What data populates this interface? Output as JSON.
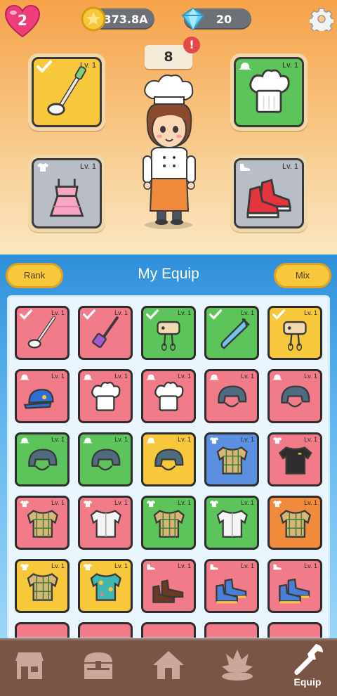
{
  "hud": {
    "lives": "2",
    "coins": "373.8A",
    "gems": "20",
    "level": "8",
    "alert": "!"
  },
  "equipped": [
    {
      "name": "ladle",
      "level": "Lv. 1",
      "color": "#f7c73c",
      "checked": true
    },
    {
      "name": "chef-hat",
      "level": "Lv. 1",
      "color": "#5cc45a",
      "checked": false
    },
    {
      "name": "pink-dress",
      "level": "Lv. 1",
      "color": "#b9bec6",
      "checked": false
    },
    {
      "name": "red-sneakers",
      "level": "Lv. 1",
      "color": "#b9bec6",
      "checked": false
    }
  ],
  "panel": {
    "title": "My Equip",
    "rank_label": "Rank",
    "mix_label": "Mix"
  },
  "inventory": [
    {
      "item": "ladle",
      "level": "Lv. 1",
      "color": "#f27b8a",
      "checked": true
    },
    {
      "item": "spatula",
      "level": "Lv. 1",
      "color": "#f27b8a",
      "checked": true
    },
    {
      "item": "mixer",
      "level": "Lv. 1",
      "color": "#5cc45a",
      "checked": true
    },
    {
      "item": "piping-bag",
      "level": "Lv. 1",
      "color": "#5cc45a",
      "checked": true
    },
    {
      "item": "mixer",
      "level": "Lv. 1",
      "color": "#f7c73c",
      "checked": true
    },
    {
      "item": "blue-cap",
      "level": "Lv. 1",
      "color": "#f27b8a",
      "checked": false
    },
    {
      "item": "chef-hat",
      "level": "Lv. 1",
      "color": "#f27b8a",
      "checked": false
    },
    {
      "item": "chef-hat",
      "level": "Lv. 1",
      "color": "#f27b8a",
      "checked": false
    },
    {
      "item": "helmet",
      "level": "Lv. 1",
      "color": "#f27b8a",
      "checked": false
    },
    {
      "item": "helmet",
      "level": "Lv. 1",
      "color": "#f27b8a",
      "checked": false
    },
    {
      "item": "helmet",
      "level": "Lv. 1",
      "color": "#5cc45a",
      "checked": false
    },
    {
      "item": "helmet",
      "level": "Lv. 1",
      "color": "#5cc45a",
      "checked": false
    },
    {
      "item": "helmet",
      "level": "Lv. 1",
      "color": "#f7c73c",
      "checked": false
    },
    {
      "item": "plaid-shirt",
      "level": "Lv. 1",
      "color": "#5b8fe0",
      "checked": false
    },
    {
      "item": "black-tshirt",
      "level": "Lv. 1",
      "color": "#f27b8a",
      "checked": false
    },
    {
      "item": "plaid-shirt",
      "level": "Lv. 1",
      "color": "#f27b8a",
      "checked": false
    },
    {
      "item": "white-shirt",
      "level": "Lv. 1",
      "color": "#f27b8a",
      "checked": false
    },
    {
      "item": "plaid-shirt",
      "level": "Lv. 1",
      "color": "#5cc45a",
      "checked": false
    },
    {
      "item": "white-shirt",
      "level": "Lv. 1",
      "color": "#5cc45a",
      "checked": false
    },
    {
      "item": "plaid-shirt",
      "level": "Lv. 1",
      "color": "#f08a3c",
      "checked": false
    },
    {
      "item": "plaid-shirt",
      "level": "Lv. 1",
      "color": "#f7c73c",
      "checked": false
    },
    {
      "item": "hawaiian-shirt",
      "level": "Lv. 1",
      "color": "#f7c73c",
      "checked": false
    },
    {
      "item": "brown-shoes",
      "level": "Lv. 1",
      "color": "#f27b8a",
      "checked": false
    },
    {
      "item": "blue-sneakers",
      "level": "Lv. 1",
      "color": "#f27b8a",
      "checked": false
    },
    {
      "item": "blue-sneakers",
      "level": "Lv. 1",
      "color": "#f27b8a",
      "checked": false
    }
  ],
  "nav": {
    "shop_icon": "shop-icon",
    "chest_icon": "chest-icon",
    "home_icon": "home-icon",
    "fire_icon": "cooking-icon",
    "equip_icon": "wrench-icon",
    "equip_label": "Equip"
  }
}
